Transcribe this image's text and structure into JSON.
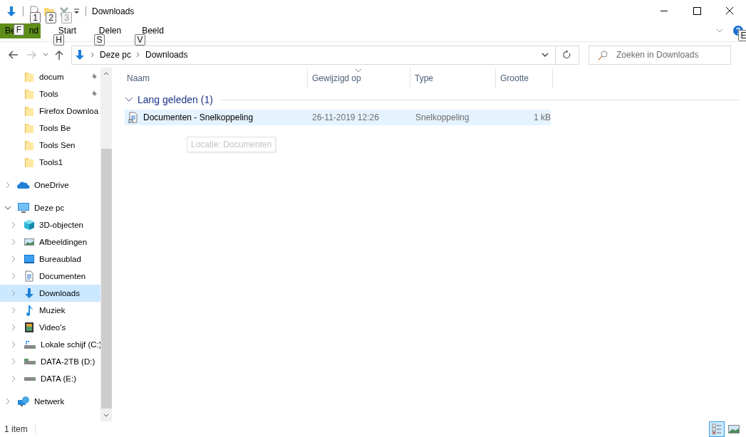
{
  "quick_access_toolbar": {
    "keytips": [
      "1",
      "2",
      "3"
    ]
  },
  "window": {
    "title": "Downloads"
  },
  "ribbon": {
    "file_tab": {
      "label_start": "Be",
      "label_end": "nd",
      "keytip": "F"
    },
    "tabs": [
      {
        "label": "Start",
        "keytip": "H",
        "selected": false
      },
      {
        "label": "Delen",
        "keytip": "S",
        "selected": false
      },
      {
        "label": "Beeld",
        "keytip": "V",
        "selected": false
      }
    ],
    "help_keytip": "E"
  },
  "navigation": [
    {
      "kind": "back",
      "disabled": false
    },
    {
      "kind": "forward",
      "disabled": true
    },
    {
      "kind": "recent",
      "disabled": false
    },
    {
      "kind": "up",
      "disabled": false
    }
  ],
  "address_bar": {
    "segments": [
      "Deze pc",
      "Downloads"
    ]
  },
  "search": {
    "placeholder": "Zoeken in Downloads"
  },
  "sidebar": {
    "quick_access": [
      {
        "label": "docum",
        "pinned": true,
        "selected": false
      },
      {
        "label": "Tools",
        "pinned": true,
        "selected": false
      },
      {
        "label": "Firefox Downloa",
        "pinned": false,
        "selected": false
      },
      {
        "label": "Tools Be",
        "pinned": false,
        "selected": false
      },
      {
        "label": "Tools Sen",
        "pinned": false,
        "selected": false
      },
      {
        "label": "Tools1",
        "pinned": false,
        "selected": false
      }
    ],
    "tree": [
      {
        "label": "OneDrive",
        "kind": "cloud",
        "expanded": false,
        "selected": false
      },
      {
        "label": "Deze pc",
        "kind": "pc",
        "expanded": true,
        "selected": false,
        "children": [
          {
            "label": "3D-objecten",
            "kind": "cube",
            "expanded": false,
            "selected": false
          },
          {
            "label": "Afbeeldingen",
            "kind": "pictures",
            "expanded": false,
            "selected": false
          },
          {
            "label": "Bureaublad",
            "kind": "desktop",
            "expanded": false,
            "selected": false
          },
          {
            "label": "Documenten",
            "kind": "document",
            "expanded": false,
            "selected": false
          },
          {
            "label": "Downloads",
            "kind": "download",
            "expanded": false,
            "selected": true
          },
          {
            "label": "Muziek",
            "kind": "music",
            "expanded": false,
            "selected": false
          },
          {
            "label": "Video's",
            "kind": "video",
            "expanded": false,
            "selected": false
          },
          {
            "label": "Lokale schijf (C:)",
            "kind": "system-drive",
            "expanded": false,
            "selected": false
          },
          {
            "label": "DATA-2TB (D:)",
            "kind": "network-drive",
            "expanded": false,
            "selected": false
          },
          {
            "label": "DATA (E:)",
            "kind": "drive",
            "expanded": false,
            "selected": false
          }
        ]
      },
      {
        "label": "Netwerk",
        "kind": "network",
        "expanded": false,
        "selected": false
      }
    ]
  },
  "columns": [
    {
      "label": "Naam",
      "sorted": false
    },
    {
      "label": "Gewijzigd op",
      "sorted": true
    },
    {
      "label": "Type",
      "sorted": false
    },
    {
      "label": "Grootte",
      "sorted": false
    }
  ],
  "groups": [
    {
      "label": "Lang geleden (1)",
      "expanded": true,
      "rows": [
        {
          "name": "Documenten - Snelkoppeling",
          "modified": "26-11-2019 12:26",
          "type": "Snelkoppeling",
          "size": "1 kB",
          "highlighted": true
        }
      ]
    }
  ],
  "tooltip": "Locatie: Documenten",
  "status_bar": {
    "item_count": "1 item",
    "views": [
      {
        "kind": "details",
        "selected": true
      },
      {
        "kind": "large-icons",
        "selected": false
      }
    ]
  }
}
